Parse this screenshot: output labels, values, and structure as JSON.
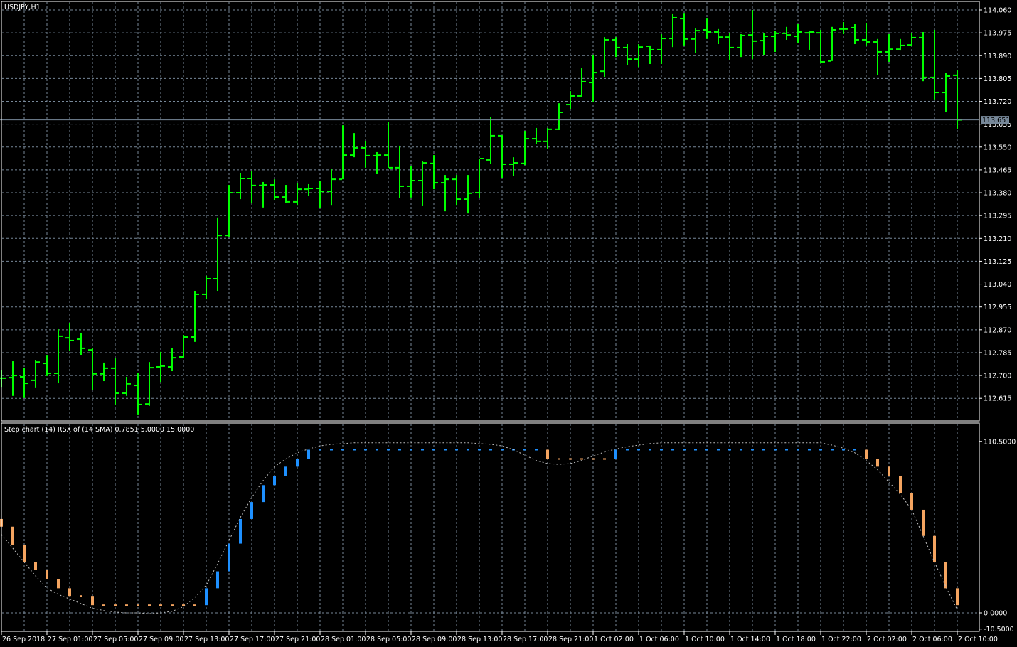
{
  "window": {
    "symbol_label": "USDJPY,H1"
  },
  "indicator": {
    "label": "Step chart (14) RSX of (14 SMA) 0.7851 5.0000 15.0000"
  },
  "colors": {
    "bar": "#00ff00",
    "grid": "#778899",
    "up": "#1e90ff",
    "down": "#f4a460",
    "curve": "#c0c0c0",
    "bid_box": "#778899"
  },
  "current_price": "113.651",
  "chart_data": [
    {
      "type": "ohlc",
      "title": "USDJPY,H1",
      "ylim": [
        112.575,
        114.08
      ],
      "y_ticks": [
        "114.060",
        "113.975",
        "113.890",
        "113.805",
        "113.720",
        "113.635",
        "113.550",
        "113.465",
        "113.380",
        "113.295",
        "113.210",
        "113.125",
        "113.040",
        "112.955",
        "112.870",
        "112.785",
        "112.700",
        "112.615"
      ],
      "x_labels": [
        "26 Sep 2018",
        "27 Sep 01:00",
        "27 Sep 05:00",
        "27 Sep 09:00",
        "27 Sep 13:00",
        "27 Sep 17:00",
        "27 Sep 21:00",
        "28 Sep 01:00",
        "28 Sep 05:00",
        "28 Sep 09:00",
        "28 Sep 13:00",
        "28 Sep 17:00",
        "28 Sep 21:00",
        "1 Oct 02:00",
        "1 Oct 06:00",
        "1 Oct 10:00",
        "1 Oct 14:00",
        "1 Oct 18:00",
        "1 Oct 22:00",
        "2 Oct 02:00",
        "2 Oct 06:00",
        "2 Oct 10:00"
      ],
      "bars_per_label": 4,
      "ohlc": [
        [
          112.69,
          112.721,
          112.655,
          112.69
        ],
        [
          112.692,
          112.753,
          112.624,
          112.7
        ],
        [
          112.695,
          112.727,
          112.616,
          112.671
        ],
        [
          112.682,
          112.756,
          112.653,
          112.75
        ],
        [
          112.745,
          112.774,
          112.698,
          112.708
        ],
        [
          112.708,
          112.872,
          112.671,
          112.846
        ],
        [
          112.84,
          112.896,
          112.793,
          112.83
        ],
        [
          112.835,
          112.859,
          112.777,
          112.801
        ],
        [
          112.795,
          112.803,
          112.647,
          112.706
        ],
        [
          112.706,
          112.748,
          112.679,
          112.727
        ],
        [
          112.727,
          112.766,
          112.592,
          112.634
        ],
        [
          112.634,
          112.695,
          112.624,
          112.669
        ],
        [
          112.663,
          112.708,
          112.555,
          112.592
        ],
        [
          112.594,
          112.75,
          112.587,
          112.729
        ],
        [
          112.732,
          112.788,
          112.676,
          112.735
        ],
        [
          112.732,
          112.801,
          112.716,
          112.766
        ],
        [
          112.769,
          112.851,
          112.766,
          112.843
        ],
        [
          112.843,
          113.015,
          112.825,
          113.002
        ],
        [
          113.002,
          113.071,
          112.983,
          113.06
        ],
        [
          113.06,
          113.288,
          113.015,
          113.221
        ],
        [
          113.221,
          113.409,
          113.216,
          113.38
        ],
        [
          113.38,
          113.454,
          113.356,
          113.433
        ],
        [
          113.433,
          113.462,
          113.34,
          113.407
        ],
        [
          113.407,
          113.42,
          113.325,
          113.409
        ],
        [
          113.409,
          113.43,
          113.351,
          113.364
        ],
        [
          113.364,
          113.409,
          113.343,
          113.346
        ],
        [
          113.346,
          113.417,
          113.332,
          113.393
        ],
        [
          113.393,
          113.412,
          113.367,
          113.396
        ],
        [
          113.396,
          113.425,
          113.322,
          113.385
        ],
        [
          113.385,
          113.47,
          113.332,
          113.43
        ],
        [
          113.43,
          113.631,
          113.43,
          113.52
        ],
        [
          113.52,
          113.602,
          113.512,
          113.547
        ],
        [
          113.547,
          113.573,
          113.473,
          113.518
        ],
        [
          113.518,
          113.531,
          113.449,
          113.52
        ],
        [
          113.52,
          113.642,
          113.473,
          113.473
        ],
        [
          113.473,
          113.555,
          113.359,
          113.404
        ],
        [
          113.404,
          113.478,
          113.362,
          113.425
        ],
        [
          113.425,
          113.497,
          113.33,
          113.491
        ],
        [
          113.489,
          113.52,
          113.393,
          113.417
        ],
        [
          113.417,
          113.446,
          113.311,
          113.43
        ],
        [
          113.43,
          113.446,
          113.332,
          113.356
        ],
        [
          113.356,
          113.446,
          113.303,
          113.378
        ],
        [
          113.38,
          113.507,
          113.359,
          113.507
        ],
        [
          113.502,
          113.663,
          113.486,
          113.592
        ],
        [
          113.592,
          113.594,
          113.433,
          113.486
        ],
        [
          113.486,
          113.512,
          113.441,
          113.491
        ],
        [
          113.489,
          113.61,
          113.483,
          113.581
        ],
        [
          113.581,
          113.621,
          113.56,
          113.571
        ],
        [
          113.571,
          113.621,
          113.544,
          113.616
        ],
        [
          113.616,
          113.713,
          113.613,
          113.679
        ],
        [
          113.708,
          113.758,
          113.69,
          113.74
        ],
        [
          113.74,
          113.843,
          113.735,
          113.793
        ],
        [
          113.79,
          113.893,
          113.719,
          113.827
        ],
        [
          113.832,
          113.959,
          113.809,
          113.949
        ],
        [
          113.949,
          113.959,
          113.885,
          113.92
        ],
        [
          113.92,
          113.933,
          113.854,
          113.877
        ],
        [
          113.877,
          113.933,
          113.848,
          113.922
        ],
        [
          113.925,
          113.928,
          113.859,
          113.912
        ],
        [
          113.912,
          113.97,
          113.859,
          113.954
        ],
        [
          113.954,
          114.047,
          113.922,
          114.031
        ],
        [
          114.028,
          114.049,
          113.928,
          113.952
        ],
        [
          113.952,
          113.991,
          113.899,
          113.983
        ],
        [
          113.986,
          114.028,
          113.952,
          113.978
        ],
        [
          113.978,
          113.989,
          113.933,
          113.959
        ],
        [
          113.959,
          113.975,
          113.875,
          113.92
        ],
        [
          113.92,
          113.97,
          113.885,
          113.965
        ],
        [
          113.967,
          114.06,
          113.877,
          113.944
        ],
        [
          113.946,
          113.975,
          113.893,
          113.962
        ],
        [
          113.962,
          113.981,
          113.904,
          113.973
        ],
        [
          113.973,
          113.997,
          113.949,
          113.967
        ],
        [
          113.962,
          114.007,
          113.938,
          113.978
        ],
        [
          113.975,
          113.981,
          113.912,
          113.978
        ],
        [
          113.975,
          113.986,
          113.864,
          113.867
        ],
        [
          113.87,
          113.997,
          113.87,
          113.986
        ],
        [
          113.989,
          114.015,
          113.97,
          113.989
        ],
        [
          113.994,
          114.007,
          113.933,
          113.949
        ],
        [
          113.949,
          114.01,
          113.928,
          113.941
        ],
        [
          113.941,
          113.952,
          113.817,
          113.904
        ],
        [
          113.904,
          113.97,
          113.867,
          113.914
        ],
        [
          113.914,
          113.952,
          113.909,
          113.928
        ],
        [
          113.93,
          113.973,
          113.925,
          113.957
        ],
        [
          113.957,
          113.978,
          113.795,
          113.809
        ],
        [
          113.809,
          113.986,
          113.727,
          113.753
        ],
        [
          113.753,
          113.827,
          113.679,
          113.814
        ],
        [
          113.817,
          113.835,
          113.616,
          113.651
        ]
      ]
    },
    {
      "type": "step",
      "title": "Step chart (14) RSX of (14 SMA) 0.7851 5.0000 15.0000",
      "ylim": [
        -10.5,
        110.5
      ],
      "y_ticks": [
        "110.5000",
        "0.0000",
        "-10.5000"
      ],
      "start_level": 61,
      "step_levels": [
        56,
        44,
        33,
        28,
        22,
        16,
        11,
        11,
        5,
        5,
        5,
        5,
        5,
        5,
        5,
        5,
        5,
        5,
        16,
        27,
        45,
        61,
        72,
        83,
        89,
        95,
        100,
        106,
        106,
        106,
        106,
        106,
        106,
        106,
        106,
        106,
        106,
        106,
        106,
        106,
        106,
        106,
        106,
        106,
        106,
        106,
        106,
        106,
        100,
        100,
        100,
        100,
        100,
        100,
        106,
        106,
        106,
        106,
        106,
        106,
        106,
        106,
        106,
        106,
        106,
        106,
        106,
        106,
        106,
        106,
        106,
        106,
        106,
        106,
        106,
        106,
        100,
        95,
        89,
        78,
        67,
        50,
        33,
        16,
        5
      ],
      "rsx_curve": [
        51,
        42,
        33,
        24,
        16,
        12,
        9,
        6,
        3,
        1.5,
        0.5,
        0,
        0,
        -0.5,
        0,
        1,
        4,
        10,
        18,
        32,
        47,
        62,
        75,
        86,
        95,
        100,
        104,
        106.5,
        108.5,
        109.5,
        110,
        110.5,
        110.5,
        110.5,
        110.5,
        110.5,
        110.5,
        110.5,
        110.5,
        110.5,
        110.5,
        110.5,
        110,
        109.5,
        108.5,
        106,
        102.5,
        99,
        97,
        96.5,
        97,
        99,
        102,
        104.5,
        106.5,
        108,
        109,
        110,
        110.5,
        110.5,
        110.5,
        110.5,
        110.5,
        110.5,
        110.5,
        110.5,
        110.5,
        110.5,
        110.5,
        110.5,
        110.5,
        110.5,
        110.5,
        109,
        107,
        104,
        99,
        93,
        85,
        77,
        67,
        50,
        33,
        17,
        2
      ]
    }
  ]
}
